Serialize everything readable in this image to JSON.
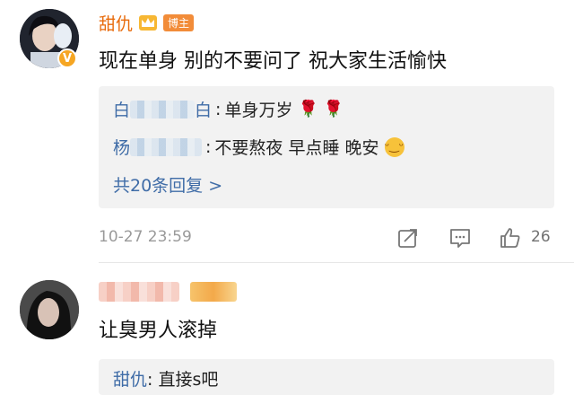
{
  "comment1": {
    "username": "甜仇",
    "tag": "博主",
    "text": "现在单身 别的不要问了 祝大家生活愉快",
    "replies": [
      {
        "name_fragment_start": "白",
        "name_fragment_end": "白",
        "sep": ":",
        "text": "单身万岁"
      },
      {
        "name_fragment_start": "杨",
        "name_fragment_end": "",
        "sep": ":",
        "text": "不要熬夜 早点睡 晚安"
      }
    ],
    "more_replies": "共20条回复 >",
    "timestamp": "10-27 23:59",
    "like_count": "26"
  },
  "comment2": {
    "text": "让臭男人滚掉",
    "reply": {
      "name": "甜仇",
      "text": ": 直接s吧"
    }
  },
  "colors": {
    "username": "#e86b0c",
    "link_blue": "#3f6ca7",
    "reply_bg": "#f2f2f2",
    "tag_bg": "#f28c39"
  }
}
